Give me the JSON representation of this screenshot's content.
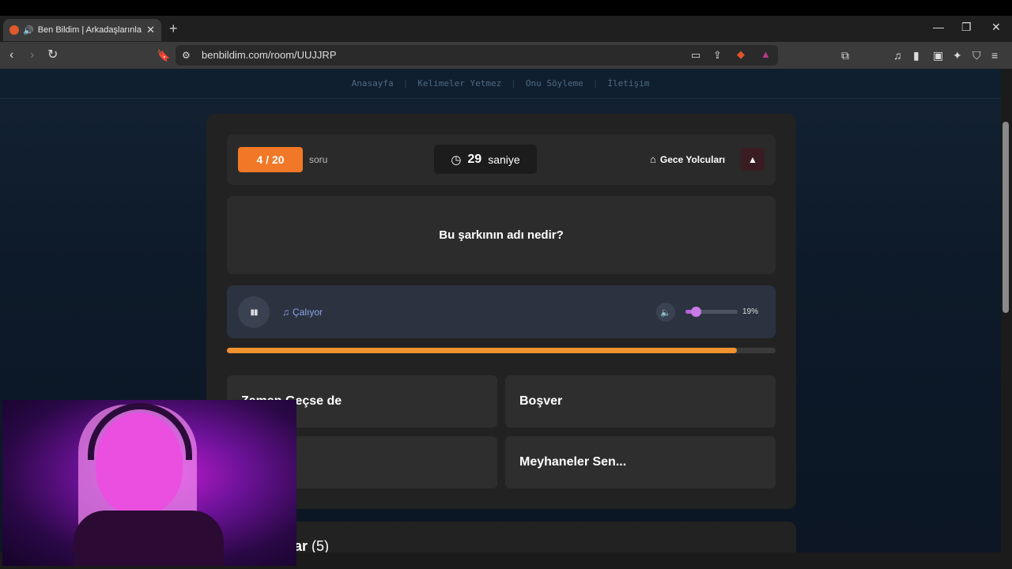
{
  "browser": {
    "tab_title": "Ben Bildim | Arkadaşlarınla Or",
    "tab_close": "✕",
    "new_tab": "+",
    "url": "benbildim.com/room/UUJJRP",
    "window_controls": [
      "—",
      "❐",
      "✕"
    ]
  },
  "site_nav": {
    "items": [
      "Anasayfa",
      "Kelimeler Yetmez",
      "Onu Söyleme",
      "İletişim"
    ],
    "separator": "|"
  },
  "game": {
    "question_counter": "4 / 20",
    "question_suffix": "soru",
    "timer_value": "29",
    "timer_unit": "saniye",
    "category": "Gece Yolcuları",
    "warning_icon": "▲",
    "question": "Bu şarkının adı nedir?",
    "player": {
      "status": "Çalıyor",
      "volume_label": "19%",
      "volume_fraction": 0.19
    },
    "progress_fraction": 0.93,
    "answers": [
      "Zaman Geçse de",
      "Boşver",
      "…n",
      "Meyhaneler Sen..."
    ]
  },
  "players_section": {
    "title": "ar",
    "count": "(5)"
  },
  "colors": {
    "accent_orange": "#f07826",
    "progress": "#f0922e",
    "volume_accent": "#b264d9",
    "playing_blue": "#8aa6e8"
  },
  "icons": {
    "clock": "clock-icon",
    "tag": "tag-icon",
    "speaker": "speaker-icon",
    "music_note": "music-note-icon"
  }
}
